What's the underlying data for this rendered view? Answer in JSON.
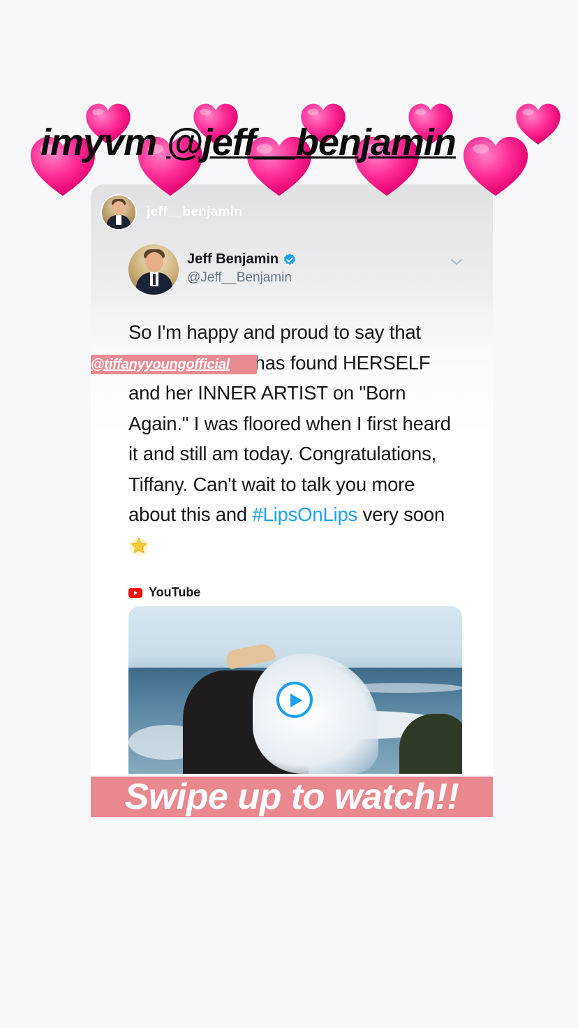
{
  "story": {
    "top_caption": {
      "prefix": "imyvm ",
      "mention": "@jeff__benjamin"
    },
    "shared_post": {
      "username": "jeff__benjamin",
      "tweet": {
        "display_name": "Jeff Benjamin",
        "handle": "@Jeff__Benjamin",
        "body_lines": [
          "So I'm happy and proud to say that",
          "@tiffanyyoung has found HERSELF",
          "and her INNER ARTIST on \"Born",
          "Again.\" I was floored when I first heard",
          "it and still am today. Congratulations,",
          "Tiffany. Can't wait to talk you more"
        ],
        "last_line_prefix": "about this and ",
        "hashtag": "#LipsOnLips",
        "last_line_suffix": " very soon",
        "source": "YouTube"
      }
    },
    "mention_sticker": "@tiffanyyoungofficial",
    "swipe_caption": "Swipe up to watch!!"
  },
  "colors": {
    "heart": "#ff1f8e",
    "sticker_bg": "#e98b93",
    "hashtag": "#1da1f2",
    "verified": "#1da1f2"
  }
}
